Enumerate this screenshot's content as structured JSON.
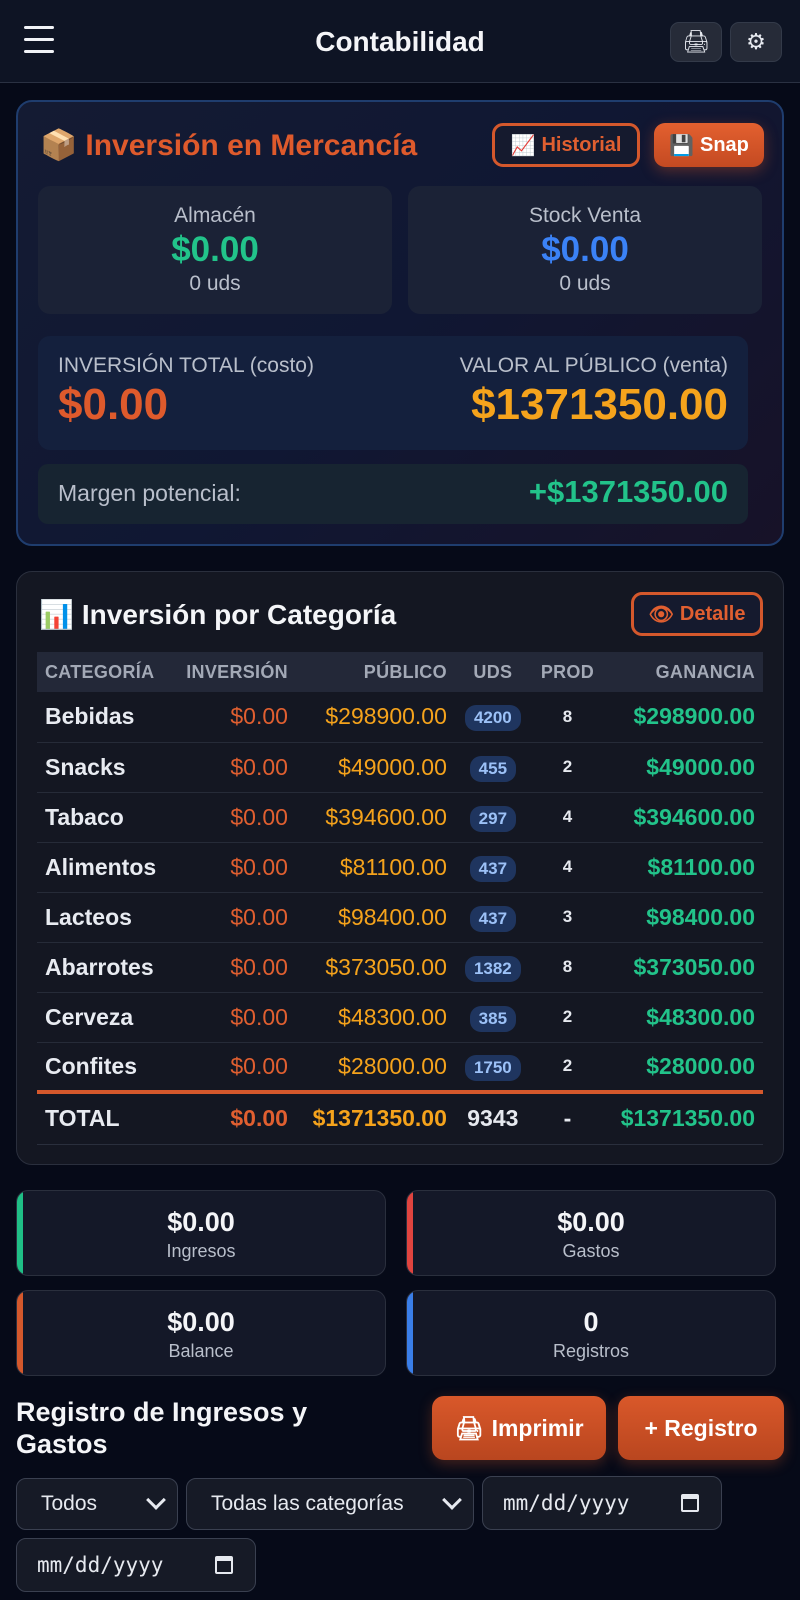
{
  "header": {
    "title": "Contabilidad",
    "print_icon": "🖨",
    "settings_icon": "⚙"
  },
  "inversion": {
    "icon": "📦",
    "title": "Inversión en Mercancía",
    "historial_label": "Historial",
    "historial_icon": "📈",
    "snap_label": "Snap",
    "snap_icon": "💾",
    "almacen": {
      "label": "Almacén",
      "value": "$0.00",
      "units": "0 uds"
    },
    "stock_venta": {
      "label": "Stock Venta",
      "value": "$0.00",
      "units": "0 uds"
    },
    "total_label": "INVERSIÓN TOTAL (costo)",
    "total_value": "$0.00",
    "publico_label": "VALOR AL PÚBLICO (venta)",
    "publico_value": "$1371350.00",
    "margen_label": "Margen potencial:",
    "margen_value": "+$1371350.00"
  },
  "categoria": {
    "icon": "📊",
    "title": "Inversión por Categoría",
    "detalle_icon": "👁",
    "detalle_label": "Detalle",
    "columns": [
      "CATEGORÍA",
      "INVERSIÓN",
      "PÚBLICO",
      "UDS",
      "PROD",
      "GANANCIA"
    ],
    "rows": [
      {
        "cat": "Bebidas",
        "inv": "$0.00",
        "pub": "$298900.00",
        "uds": "4200",
        "prod": "8",
        "gan": "$298900.00"
      },
      {
        "cat": "Snacks",
        "inv": "$0.00",
        "pub": "$49000.00",
        "uds": "455",
        "prod": "2",
        "gan": "$49000.00"
      },
      {
        "cat": "Tabaco",
        "inv": "$0.00",
        "pub": "$394600.00",
        "uds": "297",
        "prod": "4",
        "gan": "$394600.00"
      },
      {
        "cat": "Alimentos",
        "inv": "$0.00",
        "pub": "$81100.00",
        "uds": "437",
        "prod": "4",
        "gan": "$81100.00"
      },
      {
        "cat": "Lacteos",
        "inv": "$0.00",
        "pub": "$98400.00",
        "uds": "437",
        "prod": "3",
        "gan": "$98400.00"
      },
      {
        "cat": "Abarrotes",
        "inv": "$0.00",
        "pub": "$373050.00",
        "uds": "1382",
        "prod": "8",
        "gan": "$373050.00"
      },
      {
        "cat": "Cerveza",
        "inv": "$0.00",
        "pub": "$48300.00",
        "uds": "385",
        "prod": "2",
        "gan": "$48300.00"
      },
      {
        "cat": "Confites",
        "inv": "$0.00",
        "pub": "$28000.00",
        "uds": "1750",
        "prod": "2",
        "gan": "$28000.00"
      }
    ],
    "total": {
      "cat": "TOTAL",
      "inv": "$0.00",
      "pub": "$1371350.00",
      "uds": "9343",
      "prod": "-",
      "gan": "$1371350.00"
    }
  },
  "stats": [
    {
      "value": "$0.00",
      "label": "Ingresos",
      "color": "#1fbf86"
    },
    {
      "value": "$0.00",
      "label": "Gastos",
      "color": "#e0443f"
    },
    {
      "value": "$0.00",
      "label": "Balance",
      "color": "#d4582c"
    },
    {
      "value": "0",
      "label": "Registros",
      "color": "#3a7ee8"
    }
  ],
  "registro": {
    "title": "Registro de Ingresos y Gastos",
    "print_icon": "🖨",
    "print_label": "Imprimir",
    "add_label": "+ Registro",
    "type_filter": "Todos",
    "category_filter": "Todas las categorías",
    "date_from_placeholder": "mm/dd/yyyy",
    "date_to_placeholder": "mm/dd/yyyy"
  },
  "colors": {
    "accent": "#d4582c",
    "gold": "#f5a31c",
    "green": "#22c38a",
    "blue": "#3b82f6"
  }
}
